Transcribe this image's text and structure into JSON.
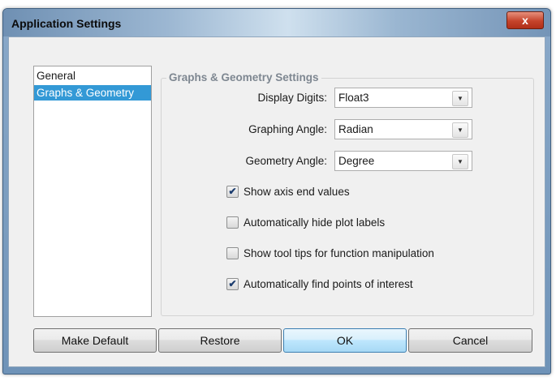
{
  "window": {
    "title": "Application Settings",
    "close_label": "x"
  },
  "sidebar": {
    "items": [
      {
        "label": "General",
        "selected": false
      },
      {
        "label": "Graphs & Geometry",
        "selected": true
      }
    ]
  },
  "settings": {
    "group_title": "Graphs & Geometry Settings",
    "display_digits": {
      "label": "Display Digits:",
      "value": "Float3"
    },
    "graphing_angle": {
      "label": "Graphing Angle:",
      "value": "Radian"
    },
    "geometry_angle": {
      "label": "Geometry Angle:",
      "value": "Degree"
    },
    "checkboxes": [
      {
        "label": "Show axis end values",
        "checked": true
      },
      {
        "label": "Automatically hide plot labels",
        "checked": false
      },
      {
        "label": "Show tool tips for function manipulation",
        "checked": false
      },
      {
        "label": "Automatically find points of interest",
        "checked": true
      }
    ]
  },
  "buttons": {
    "make_default": "Make Default",
    "restore": "Restore",
    "ok": "OK",
    "cancel": "Cancel"
  },
  "icons": {
    "close": "close-icon",
    "dropdown": "chevron-down-icon",
    "check": "checkmark-icon"
  }
}
